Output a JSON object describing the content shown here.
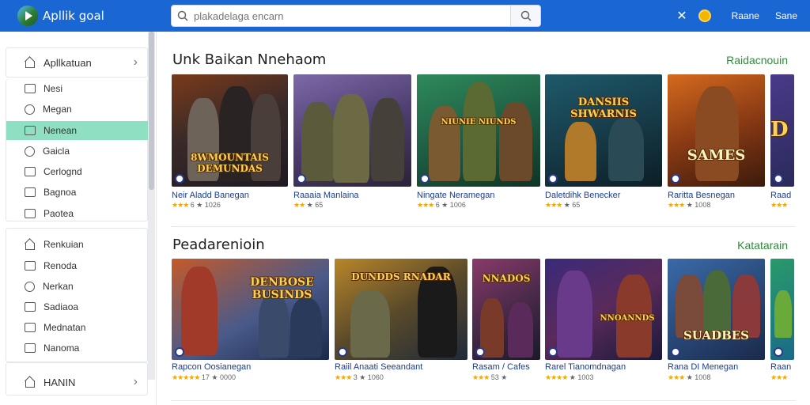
{
  "header": {
    "app_name": "Apllik goal",
    "search_placeholder": "plakadelaga encarn",
    "links": [
      "Raane",
      "Sane"
    ]
  },
  "sidebar": {
    "group1": {
      "label": "Apllkatuan"
    },
    "items1": [
      "Nesi",
      "Megan",
      "Nenean",
      "Gaicla",
      "Cerlognd",
      "Bagnoa",
      "Paotea"
    ],
    "active_index": 2,
    "items2": [
      "Renkuian",
      "Renoda",
      "Nerkan",
      "Sadiaoa",
      "Mednatan",
      "Nanoma"
    ],
    "group3": {
      "label": "HANIN"
    }
  },
  "sections": [
    {
      "title": "Unk Baikan Nnehaom",
      "link": "Raidacnouin",
      "cards": [
        {
          "title": "Neir Aladd Banegan",
          "rating": "★★★",
          "meta": "6 ★ 1026",
          "art": "8WMOUNTAIS DEMUNDAS"
        },
        {
          "title": "Raaaia Manlaina",
          "rating": "★★",
          "meta": "★ 65",
          "art": ""
        },
        {
          "title": "Ningate Neramegan",
          "rating": "★★★",
          "meta": "6 ★ 1006",
          "art": "NIUNIE NIUNDS"
        },
        {
          "title": "Daletdihk Benecker",
          "rating": "★★★",
          "meta": "★ 65",
          "art": "DANSIIS SHWARNIS"
        },
        {
          "title": "Raritta Besnegan",
          "rating": "★★★",
          "meta": "★ 1008",
          "art": "SAMES"
        },
        {
          "title": "Raad",
          "rating": "★★★",
          "meta": "",
          "art": "D"
        }
      ]
    },
    {
      "title": "Peadarenioin",
      "link": "Katatarain",
      "cards": [
        {
          "title": "Rapcon Oosianegan",
          "rating": "★★★★★",
          "meta": "17 ★ 0000",
          "art": "DENBOSE BUSINDS"
        },
        {
          "title": "Raiil Anaati Seeandant",
          "rating": "★★★",
          "meta": "3 ★ 1060",
          "art": "DUNDDS RNADAR"
        },
        {
          "title": "Rasam / Cafes",
          "rating": "★★★",
          "meta": "53 ★",
          "art": "NNADOS"
        },
        {
          "title": "Rarel Tianomdnagan",
          "rating": "★★★★",
          "meta": "★ 1003",
          "art": "NNOANNDS"
        },
        {
          "title": "Rana DI Menegan",
          "rating": "★★★",
          "meta": "★ 1008",
          "art": "SUADBES"
        },
        {
          "title": "Raan",
          "rating": "★★★",
          "meta": "",
          "art": ""
        }
      ]
    }
  ],
  "colors": {
    "header_bg": "#1a66d2",
    "active_item": "#8fe0c2",
    "link_green": "#2e8b3a",
    "title_blue": "#1a3d8f",
    "star": "#f2a60c"
  }
}
